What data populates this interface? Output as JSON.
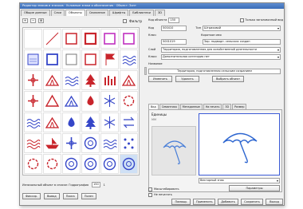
{
  "window": {
    "title": "Редактор знаков и значков · Условные знаки и обозначения · Объект: Зонт"
  },
  "tabs": [
    {
      "label": "Общие данные"
    },
    {
      "label": "Слои"
    },
    {
      "label": "Объекты"
    },
    {
      "label": "Связанное"
    },
    {
      "label": "Шрифты"
    },
    {
      "label": "Библиотеки"
    },
    {
      "label": "3D"
    }
  ],
  "left_toolbar": {
    "tool1": "+",
    "tool2": "−",
    "tool3": "⊞",
    "filter_label": "Фильтр"
  },
  "palette": {
    "colors": {
      "blue": "#3546c8",
      "red": "#c8242b",
      "magenta": "#c030c0",
      "sel_bg": "#cfe0f5"
    },
    "icons": [
      "empty",
      "line",
      "square-red",
      "square-red-bold",
      "square-magenta",
      "square-magenta-2",
      "square-pattern",
      "square-blue",
      "square-outline",
      "square-red-2",
      "flag",
      "blue-waves",
      "cross-red",
      "hut-red",
      "lines-blue",
      "tree-red",
      "bars-red",
      "tent-red",
      "cross-small",
      "triangle-red",
      "tent-blue",
      "drop-red",
      "ice-blue",
      "steam-red",
      "waves-blue",
      "building-red",
      "drop-blue",
      "tree-blue",
      "snow-blue",
      "arrows-blue",
      "waves-red",
      "ship-red",
      "anchor-blue",
      "circle-blue",
      "wave-lines-blue",
      "dots-blue",
      "gear-red",
      "spiral-red",
      "circle-sun-blue",
      "circle-face-blue",
      "circle-eye-blue",
      "circle-umbrella-blue"
    ]
  },
  "left_status": {
    "text": "Изначальный объект в списке: Гидрография",
    "count": "150",
    "page": "1"
  },
  "left_buttons": {
    "first": "Фиксир.",
    "second": "Вывод",
    "third": "Поиск",
    "fourth": "Полез"
  },
  "properties": {
    "code_label": "Код объекта",
    "code_value": "150",
    "only_tag_label": "Только заголовочный вид",
    "kind_label": "Код",
    "kind_value": "500410",
    "type_label": "Тип",
    "type_value": "Штриховой",
    "key_label": "Ключ",
    "key_value": "5001019",
    "short_label": "Короткое имя",
    "short_value": "Зар. подводн. сельских создан",
    "layer_label": "Слой",
    "layer_value": "Территория, подготовленная для хозяйственной деятельности",
    "class_label": "Класс",
    "class_value": "Дополнительная категория нет",
    "name_label": "Название",
    "name_value": "Территория, подготовленная сельским созданием",
    "btn_change": "Изменить",
    "btn_delete": "Удалить",
    "btn_pick": "Выбрать объект"
  },
  "inner_tabs": [
    {
      "label": "Вид"
    },
    {
      "label": "Семантика"
    },
    {
      "label": "Метаданные"
    },
    {
      "label": "На печать"
    },
    {
      "label": "3D"
    },
    {
      "label": "Размер"
    }
  ],
  "preview": {
    "scale_label": "Единицы",
    "unit_value": "мм",
    "symbol_value": "Векторный знак",
    "params_label": "Параметры",
    "cb1": "Масштабировать",
    "cb2": "Не печатать"
  },
  "bottom_buttons": {
    "help": "Помощь",
    "apply": "Применить",
    "add": "Добавить",
    "ok": "Сохранить",
    "cancel": "Выход"
  }
}
